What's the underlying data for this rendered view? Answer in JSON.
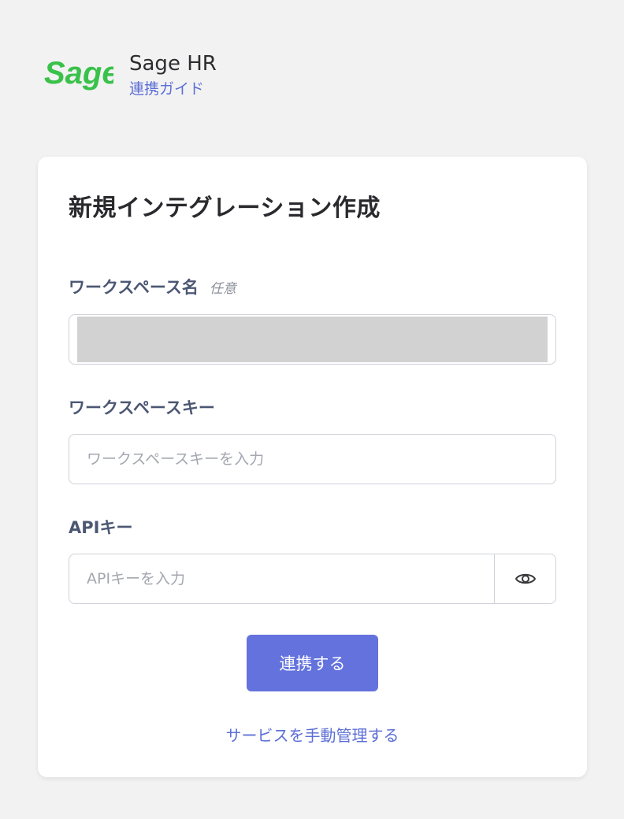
{
  "header": {
    "logo_text": "Sage",
    "app_name": "Sage HR",
    "guide_link": "連携ガイド"
  },
  "form": {
    "title": "新規インテグレーション作成",
    "workspace_name": {
      "label": "ワークスペース名",
      "optional": "任意"
    },
    "workspace_key": {
      "label": "ワークスペースキー",
      "placeholder": "ワークスペースキーを入力"
    },
    "api_key": {
      "label": "APIキー",
      "placeholder": "APIキーを入力"
    },
    "submit_label": "連携する",
    "manual_link": "サービスを手動管理する"
  },
  "colors": {
    "brand_green": "#3ac14a",
    "accent": "#6372dd",
    "link": "#5b6ed6",
    "label": "#4c5773"
  },
  "icons": {
    "visibility_toggle": "eye-icon"
  }
}
